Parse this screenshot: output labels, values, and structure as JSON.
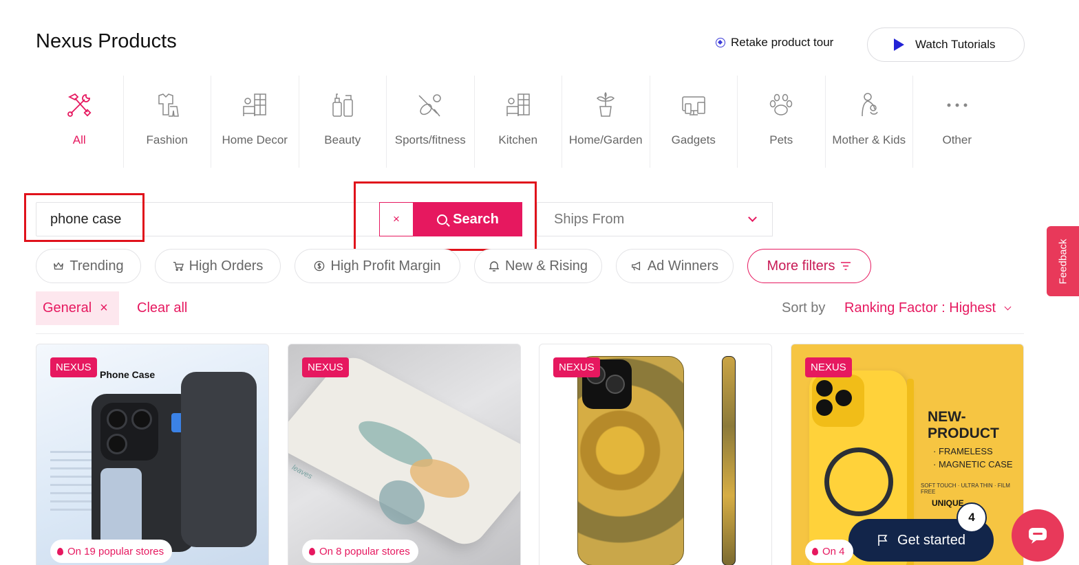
{
  "header": {
    "title": "Nexus Products",
    "tour_label": "Retake product tour",
    "watch_label": "Watch Tutorials"
  },
  "categories": [
    {
      "label": "All",
      "icon": "tools-icon",
      "active": true
    },
    {
      "label": "Fashion",
      "icon": "clothing-icon"
    },
    {
      "label": "Home Decor",
      "icon": "furniture-icon"
    },
    {
      "label": "Beauty",
      "icon": "cosmetics-icon"
    },
    {
      "label": "Sports/fitness",
      "icon": "sports-icon"
    },
    {
      "label": "Kitchen",
      "icon": "kitchen-icon"
    },
    {
      "label": "Home/Garden",
      "icon": "plant-icon"
    },
    {
      "label": "Gadgets",
      "icon": "devices-icon"
    },
    {
      "label": "Pets",
      "icon": "paw-icon"
    },
    {
      "label": "Mother & Kids",
      "icon": "mother-child-icon"
    },
    {
      "label": "Other",
      "icon": "more-dots-icon"
    }
  ],
  "search": {
    "value": "phone case",
    "button_label": "Search",
    "clear_symbol": "×"
  },
  "ships_from": {
    "label": "Ships From"
  },
  "filter_chips": [
    {
      "label": "Trending",
      "icon": "crown-icon"
    },
    {
      "label": "High Orders",
      "icon": "cart-icon"
    },
    {
      "label": "High Profit Margin",
      "icon": "dollar-icon"
    },
    {
      "label": "New & Rising",
      "icon": "bell-icon"
    },
    {
      "label": "Ad Winners",
      "icon": "megaphone-icon"
    },
    {
      "label": "More filters",
      "icon": "filter-icon"
    }
  ],
  "active_filter": {
    "label": "General",
    "remove_symbol": "×"
  },
  "clear_all": "Clear all",
  "sort": {
    "label": "Sort by",
    "value": "Ranking Factor : Highest"
  },
  "products": [
    {
      "badge": "NEXUS",
      "stores": "On 19 popular stores",
      "image_text": "Phone Case"
    },
    {
      "badge": "NEXUS",
      "stores": "On 8 popular stores",
      "image_text": "leaves"
    },
    {
      "badge": "NEXUS",
      "stores": "",
      "image_text": ""
    },
    {
      "badge": "NEXUS",
      "stores": "On 4",
      "image_text": "NEW-PRODUCT",
      "image_lines": [
        "· FRAMELESS",
        "· MAGNETIC CASE",
        "SOFT TOUCH · ULTRA THIN · FILM FREE",
        "UNIQUE"
      ]
    }
  ],
  "feedback": "Feedback",
  "get_started": {
    "label": "Get started",
    "count": "4"
  },
  "colors": {
    "accent": "#e6185f",
    "navy": "#12254a",
    "highlight": "#e0121b"
  }
}
